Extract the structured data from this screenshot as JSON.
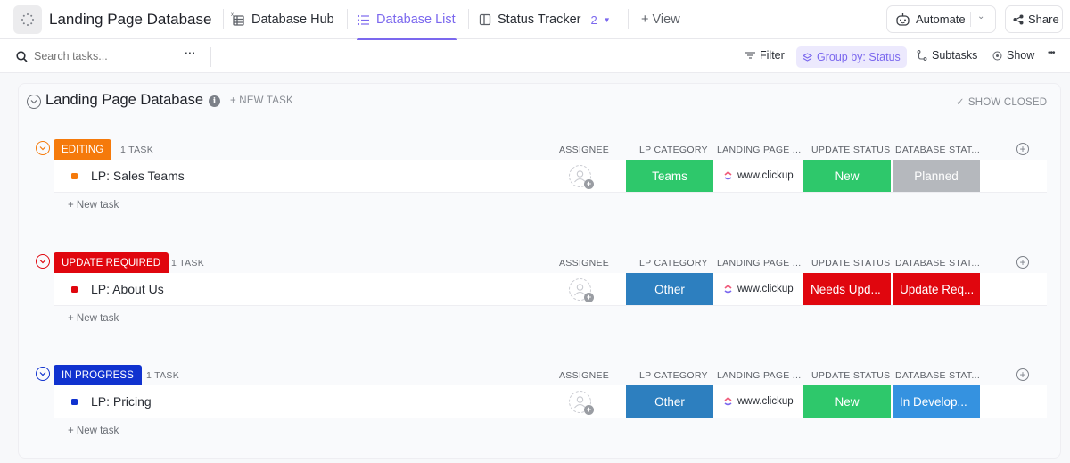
{
  "header": {
    "title": "Landing Page Database",
    "tabs": [
      {
        "label": "Database Hub",
        "icon": "table-icon",
        "active": false
      },
      {
        "label": "Database List",
        "icon": "list-icon",
        "active": true
      },
      {
        "label": "Status Tracker",
        "icon": "board-icon",
        "active": false,
        "count": "2"
      }
    ],
    "add_view": "+ View",
    "automate_label": "Automate",
    "share_label": "Share"
  },
  "toolbar": {
    "search_placeholder": "Search tasks...",
    "more": "···",
    "filter": "Filter",
    "group_by": "Group by: Status",
    "subtasks": "Subtasks",
    "show": "Show",
    "overflow": "•••"
  },
  "list": {
    "title": "Landing Page Database",
    "new_task": "+ NEW TASK",
    "show_closed": "SHOW CLOSED",
    "columns": [
      "ASSIGNEE",
      "LP CATEGORY",
      "LANDING PAGE ...",
      "UPDATE STATUS",
      "DATABASE STAT..."
    ],
    "new_task_row": "+ New task",
    "groups": [
      {
        "status": "EDITING",
        "color": "#f57a0b",
        "count": "1 TASK",
        "task": {
          "name": "LP: Sales Teams",
          "lp_category": {
            "label": "Teams",
            "color": "#2ec86b"
          },
          "landing_page": "www.clickup",
          "update_status": {
            "label": "New",
            "color": "#2ec86b"
          },
          "database_status": {
            "label": "Planned",
            "color": "#b5b8bd"
          }
        }
      },
      {
        "status": "UPDATE REQUIRED",
        "color": "#e0060e",
        "count": "1 TASK",
        "task": {
          "name": "LP: About Us",
          "lp_category": {
            "label": "Other",
            "color": "#2d7fbf"
          },
          "landing_page": "www.clickup",
          "update_status": {
            "label": "Needs Upd...",
            "color": "#e0060e"
          },
          "database_status": {
            "label": "Update Req...",
            "color": "#e0060e"
          }
        }
      },
      {
        "status": "IN PROGRESS",
        "color": "#1032cf",
        "count": "1 TASK",
        "task": {
          "name": "LP: Pricing",
          "lp_category": {
            "label": "Other",
            "color": "#2d7fbf"
          },
          "landing_page": "www.clickup",
          "update_status": {
            "label": "New",
            "color": "#2ec86b"
          },
          "database_status": {
            "label": "In Develop...",
            "color": "#3592e0"
          }
        }
      }
    ]
  }
}
